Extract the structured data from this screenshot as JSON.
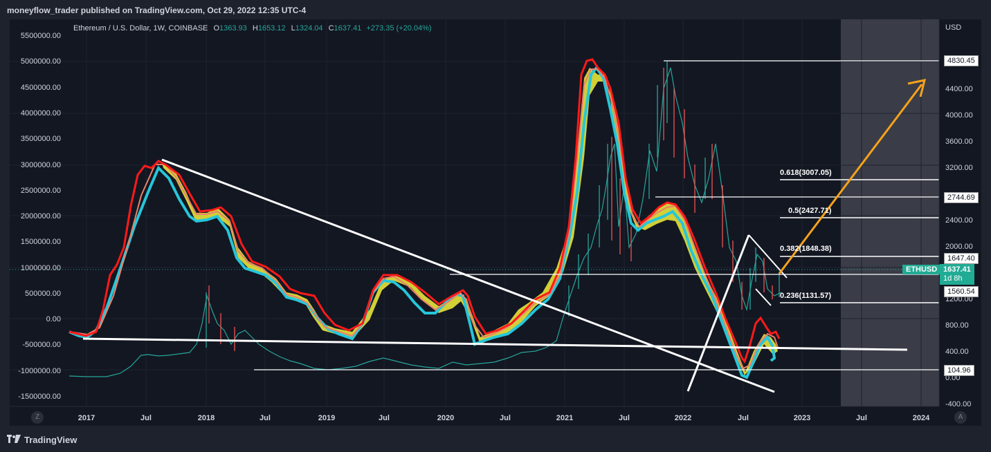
{
  "header": {
    "published": "moneyflow_trader published on TradingView.com, Oct 29, 2022 12:35 UTC-4"
  },
  "legend": {
    "symbol": "Ethereum / U.S. Dollar, 1W, COINBASE",
    "o_label": "O",
    "o_value": "1363.93",
    "h_label": "H",
    "h_value": "1653.12",
    "l_label": "L",
    "l_value": "1324.04",
    "c_label": "C",
    "c_value": "1637.41",
    "change": "+273.35 (+20.04%)"
  },
  "left_axis": [
    "5500000.00",
    "5000000.00",
    "4500000.00",
    "4000000.00",
    "3500000.00",
    "3000000.00",
    "2500000.00",
    "2000000.00",
    "1500000.00",
    "1000000.00",
    "500000.00",
    "0.00",
    "-500000.00",
    "-1000000.00",
    "-1500000.00"
  ],
  "right_axis": {
    "currency": "USD",
    "ticks": [
      "4400.00",
      "4000.00",
      "3600.00",
      "3200.00",
      "2400.00",
      "2000.00",
      "1200.00",
      "800.00",
      "400.00",
      "0.00",
      "-400.00"
    ],
    "price_tags": {
      "t4830": "4830.45",
      "t2744": "2744.69",
      "t1647": "1647.40",
      "t1560": "1560.54",
      "t104": "104.96"
    },
    "eth_label": "ETHUSD",
    "eth_price": "1637.41",
    "eth_countdown": "1d 8h"
  },
  "fib_levels": {
    "f618": "0.618(3007.05)",
    "f05": "0.5(2427.71)",
    "f382": "0.382(1848.38)",
    "f236": "0.236(1131.57)"
  },
  "x_axis": [
    "2017",
    "Jul",
    "2018",
    "Jul",
    "2019",
    "Jul",
    "2020",
    "Jul",
    "2021",
    "Jul",
    "2022",
    "Jul",
    "2023",
    "Jul",
    "2024"
  ],
  "buttons": {
    "z": "Z",
    "a": "A"
  },
  "footer": {
    "brand": "TradingView"
  },
  "colors": {
    "bg": "#131722",
    "up": "#26a69a",
    "down": "#ef5350",
    "red_line": "#ff1a1a",
    "yellow_fill": "#e8e33a",
    "cyan_line": "#26c6da",
    "orange_arrow": "#f7a21b"
  }
}
